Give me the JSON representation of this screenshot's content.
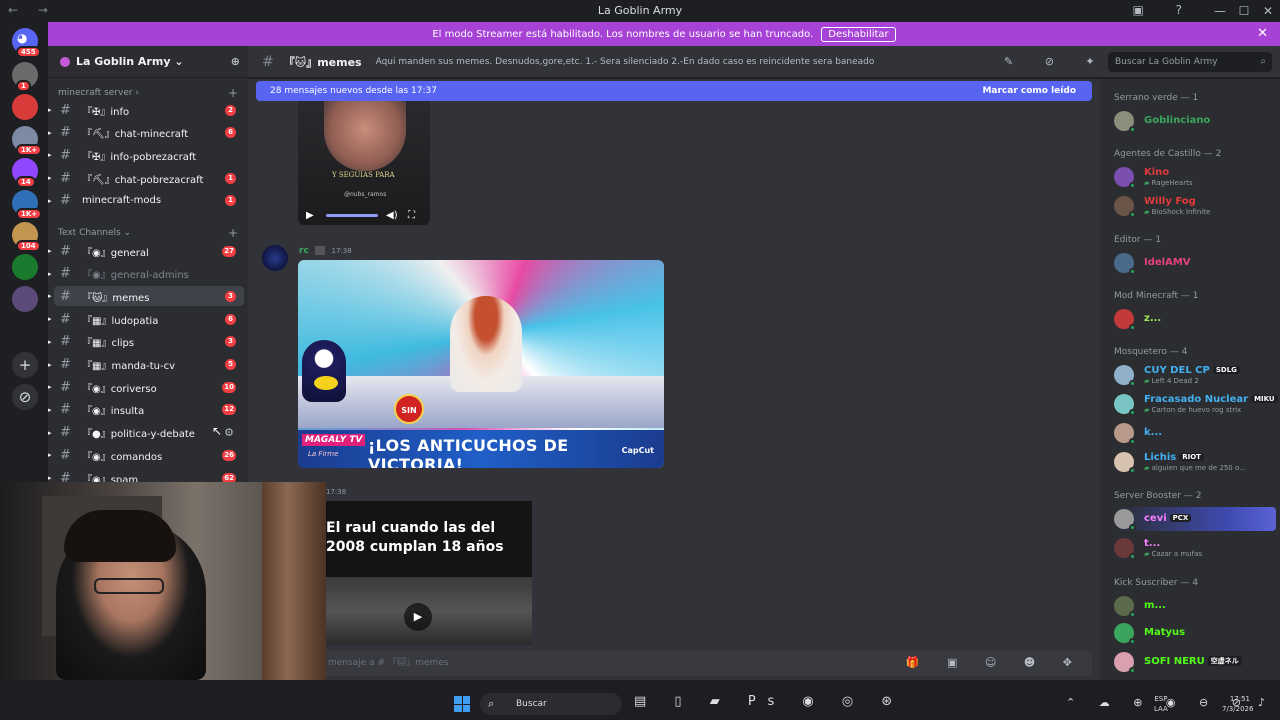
{
  "window": {
    "title": "La Goblin Army",
    "nav": "← →",
    "controls": [
      "—",
      "☐",
      "✕"
    ],
    "top_icons": "▣ ?"
  },
  "servers": {
    "home_badge": "455",
    "items": [
      {
        "badge": "1",
        "color": "#6b6b6b"
      },
      {
        "badge": "",
        "color": "#d93a3a"
      },
      {
        "badge": "1K+",
        "color": "#7d8aa3"
      },
      {
        "badge": "14",
        "color": "#9146ff"
      },
      {
        "badge": "1K+",
        "color": "#2f6fb8"
      },
      {
        "badge": "104",
        "color": "#c2964f"
      },
      {
        "badge": "",
        "color": "#1a7a2e"
      },
      {
        "badge": "",
        "color": "#5c4a7a"
      }
    ],
    "add_label": "+",
    "discover_label": "⊘"
  },
  "banner": {
    "text": "El modo Streamer está habilitado. Los nombres de usuario se han truncado.",
    "button": "Deshabilitar",
    "close": "✕"
  },
  "sidebar": {
    "server_name": "La Goblin Army ⌄",
    "add_icon": "⊕",
    "categories": [
      {
        "label": "minecraft server ›"
      },
      {
        "label": "Text Channels ⌄"
      }
    ],
    "minecraft_channels": [
      {
        "name": "『✠』info",
        "count": "2"
      },
      {
        "name": "『⛏』chat-minecraft",
        "count": "6"
      },
      {
        "name": "『✠』info-pobrezacraft",
        "count": ""
      },
      {
        "name": "『⛏』chat-pobrezacraft",
        "count": "1"
      },
      {
        "name": "minecraft-mods",
        "count": "1"
      }
    ],
    "text_channels": [
      {
        "name": "『◉』general",
        "count": "27"
      },
      {
        "name": "『◉』general-admins",
        "count": ""
      },
      {
        "name": "『🐱』memes",
        "count": "3"
      },
      {
        "name": "『▦』ludopatia",
        "count": "6"
      },
      {
        "name": "『▦』clips",
        "count": "3"
      },
      {
        "name": "『▦』manda-tu-cv",
        "count": "5"
      },
      {
        "name": "『◉』coriverso",
        "count": "10"
      },
      {
        "name": "『◉』insulta",
        "count": "12"
      },
      {
        "name": "『●』politica-y-debate",
        "count": "⚙"
      },
      {
        "name": "『◉』comandos",
        "count": "26"
      },
      {
        "name": "『◉』spam",
        "count": "62"
      }
    ]
  },
  "channel_header": {
    "hash": "#",
    "name": "『🐱』memes",
    "topic": "Aqui manden sus memes. Desnudos,gore,etc. 1.- Sera silenciado 2.-En dado caso es reincidente sera baneado",
    "icons": "✎ ⊘ ✦ ⚇",
    "search_placeholder": "Buscar La Goblin Army",
    "search_icon": "⌕"
  },
  "chat": {
    "new_messages": "28 mensajes nuevos desde las 17:37",
    "mark_read": "Marcar como leído",
    "video1": {
      "caption": "Y SEGUIAS PARA",
      "handle": "@nubs_ramos"
    },
    "message2": {
      "author": "rc",
      "time": "17:38"
    },
    "image2": {
      "sin_badge": "SIN",
      "logo": "MAGALY TV",
      "logo_sub": "La Firme",
      "headline": "¡LOS ANTICUCHOS DE VICTORIA!",
      "watermark": "CapCut"
    },
    "message3": {
      "time": "17:38"
    },
    "video3": {
      "line1": "El  raul  cuando las del",
      "line2": "2008 cumplan 18 años"
    }
  },
  "composer": {
    "placeholder": "mensaje a # 『🐱』memes",
    "icons": "🎁 ▣ ☺ ☻ ✥"
  },
  "members": {
    "groups": [
      {
        "title": "Serrano verde — 1",
        "members": [
          {
            "name": "Goblinciano",
            "color": "#3ba55d",
            "activity": "",
            "tag": "",
            "avatar": "#8a8f7c"
          }
        ]
      },
      {
        "title": "Agentes de Castillo — 2",
        "members": [
          {
            "name": "Kino",
            "color": "#e03b3b",
            "activity": "RageHearts",
            "tag": "",
            "avatar": "#7a4fb0"
          },
          {
            "name": "Willy Fog",
            "color": "#e03b3b",
            "activity": "BioShock Infinite",
            "tag": "",
            "avatar": "#6b5448"
          }
        ]
      },
      {
        "title": "Editor — 1",
        "members": [
          {
            "name": "IdelAMV",
            "color": "#e6427a",
            "activity": "",
            "tag": "",
            "avatar": "#4a6a8a"
          }
        ]
      },
      {
        "title": "Mod Minecraft — 1",
        "members": [
          {
            "name": "z...",
            "color": "#a0e85b",
            "activity": "",
            "tag": "",
            "avatar": "#c23a3a"
          }
        ]
      },
      {
        "title": "Mosquetero — 4",
        "members": [
          {
            "name": "CUY DEL CP",
            "color": "#43b0f1",
            "activity": "Left 4 Dead 2",
            "tag": "SDLG",
            "avatar": "#8fb0c8"
          },
          {
            "name": "Fracasado Nuclear",
            "color": "#43b0f1",
            "activity": "Carton de huevo rog strix",
            "tag": "MIKU",
            "avatar": "#7ac4c4"
          },
          {
            "name": "k...",
            "color": "#43b0f1",
            "activity": "",
            "tag": "",
            "avatar": "#b89a8a"
          },
          {
            "name": "Lichis",
            "color": "#43b0f1",
            "activity": "alguien que me de 250 o...",
            "tag": "RIOT",
            "avatar": "#d7c2b0"
          }
        ]
      },
      {
        "title": "Server Booster — 2",
        "members": [
          {
            "name": "cevi",
            "color": "#f47fff",
            "activity": "",
            "tag": "PCX",
            "avatar": "#9a9a9a"
          },
          {
            "name": "t...",
            "color": "#f47fff",
            "activity": "Cazar a mufas",
            "tag": "",
            "avatar": "#6a3a3a"
          }
        ]
      },
      {
        "title": "Kick Suscriber — 4",
        "members": [
          {
            "name": "m...",
            "color": "#53fc18",
            "activity": "",
            "tag": "",
            "avatar": "#5a6a4a"
          },
          {
            "name": "Matyus",
            "color": "#53fc18",
            "activity": "",
            "tag": "",
            "avatar": "#3ba55d"
          },
          {
            "name": "SOFI NERU",
            "color": "#53fc18",
            "activity": "",
            "tag": "空虚ネル",
            "avatar": "#d9a0b0"
          }
        ]
      }
    ]
  },
  "taskbar": {
    "search": "Buscar",
    "search_icon": "⌕",
    "apps": "▤ ▯ ▰ Ps ◉ ◎ ⊛",
    "tray": "⌃ ☁ ⊕ ◉ ⊖ ⊘",
    "lang1": "ESP",
    "lang2": "LAA",
    "time": "17:51",
    "date": "7/3/2026",
    "bell": "♪"
  }
}
